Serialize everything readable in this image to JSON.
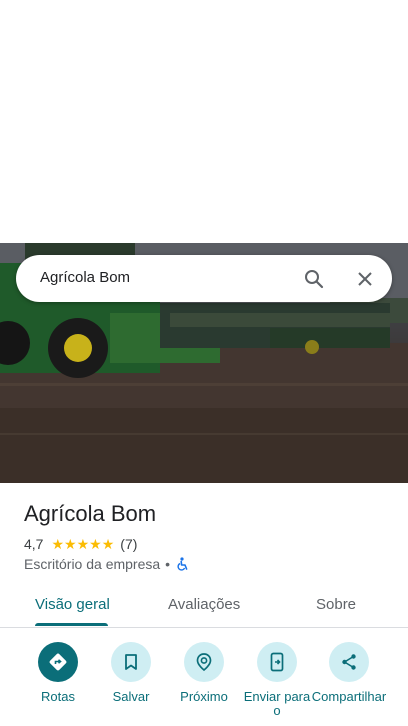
{
  "search": {
    "query": "Agrícola Bom"
  },
  "place": {
    "name": "Agrícola Bom",
    "rating": "4,7",
    "stars": 4.7,
    "review_count": "(7)",
    "category": "Escritório da empresa",
    "separator": "•"
  },
  "tabs": [
    {
      "label": "Visão geral",
      "active": true
    },
    {
      "label": "Avaliações",
      "active": false
    },
    {
      "label": "Sobre",
      "active": false
    }
  ],
  "actions": [
    {
      "label": "Rotas",
      "icon": "directions-icon"
    },
    {
      "label": "Salvar",
      "icon": "bookmark-icon"
    },
    {
      "label": "Próximo",
      "icon": "nearby-icon"
    },
    {
      "label": "Enviar para o",
      "icon": "send-to-phone-icon"
    },
    {
      "label": "Compartilhar",
      "icon": "share-icon"
    }
  ],
  "colors": {
    "accent": "#0b6e79",
    "star": "#fbbc04",
    "action_bg": "#cfeef3"
  }
}
